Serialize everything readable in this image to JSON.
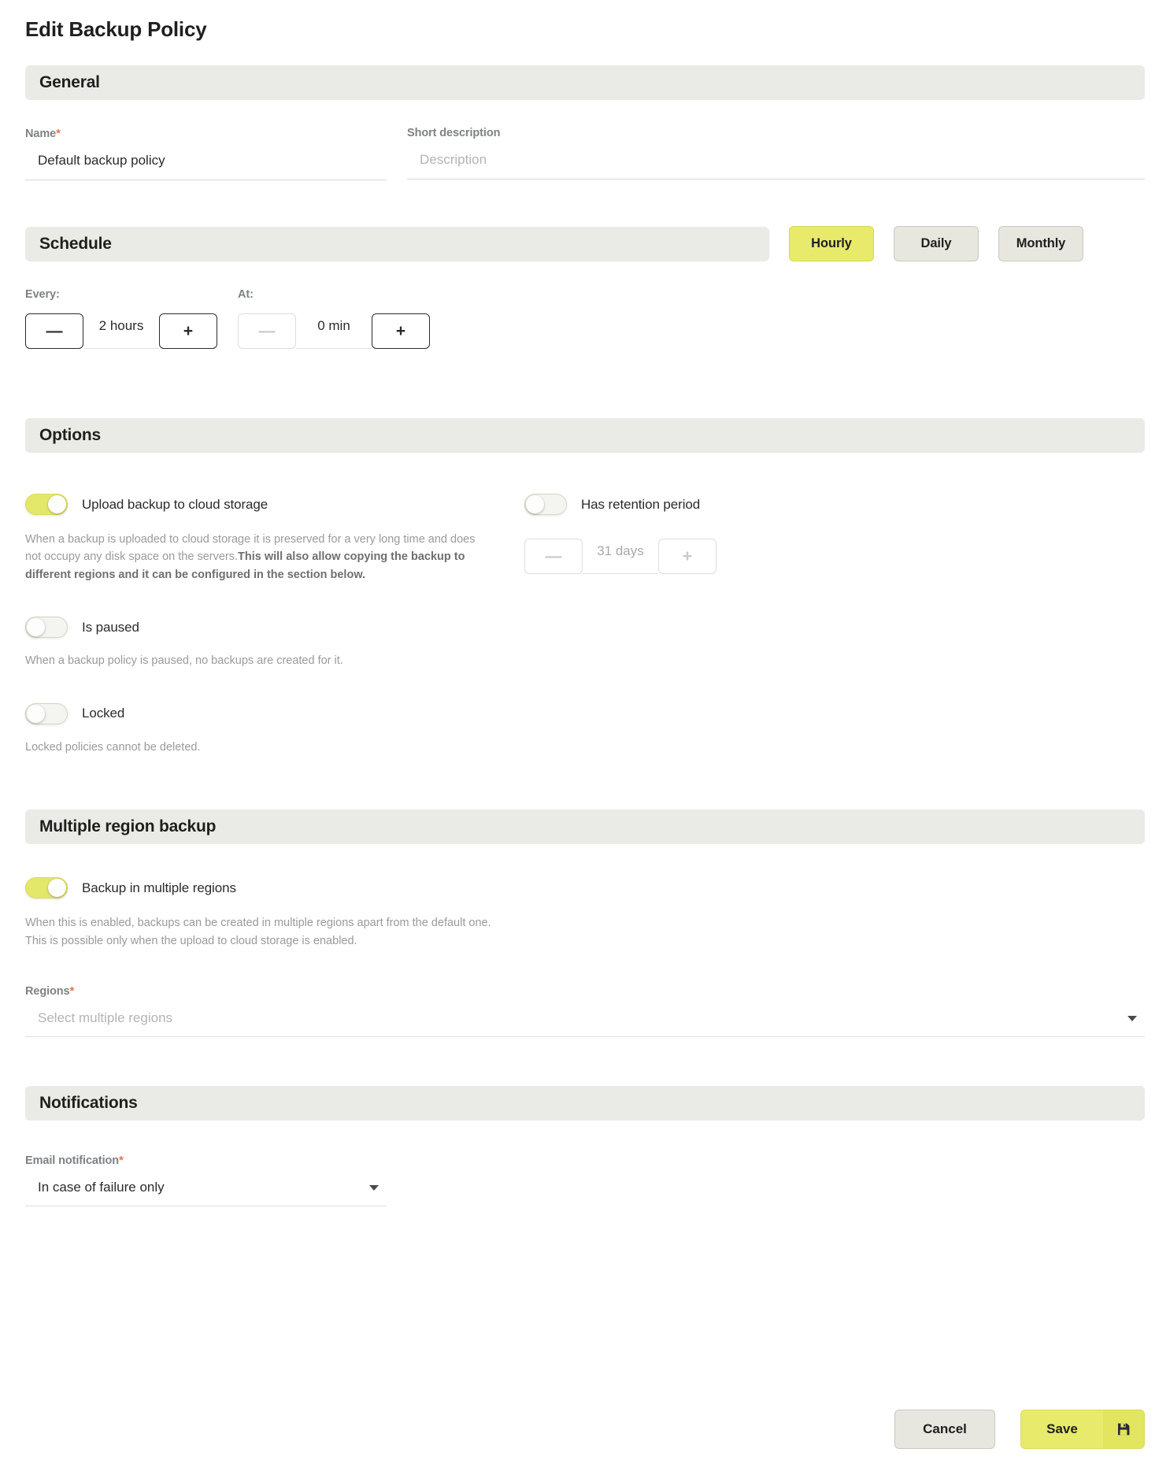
{
  "page_title": "Edit Backup Policy",
  "general": {
    "section_title": "General",
    "name_label": "Name",
    "name_required": "*",
    "name_value": "Default backup policy",
    "desc_label": "Short description",
    "desc_value": "",
    "desc_placeholder": "Description"
  },
  "schedule": {
    "section_title": "Schedule",
    "tabs": [
      {
        "label": "Hourly",
        "active": true
      },
      {
        "label": "Daily",
        "active": false
      },
      {
        "label": "Monthly",
        "active": false
      }
    ],
    "every_label": "Every:",
    "every_value": "2 hours",
    "every_minus": "—",
    "every_plus": "+",
    "at_label": "At:",
    "at_value": "0 min",
    "at_minus": "—",
    "at_plus": "+"
  },
  "options": {
    "section_title": "Options",
    "upload": {
      "label": "Upload backup to cloud storage",
      "state": "on",
      "help_normal": "When a backup is uploaded to cloud storage it is preserved for a very long time and does not occupy any disk space on the servers.",
      "help_bold": "This will also allow copying the backup to different regions and it can be configured in the section below."
    },
    "retention": {
      "label": "Has retention period",
      "state": "off",
      "value": "31 days",
      "minus": "—",
      "plus": "+"
    },
    "paused": {
      "label": "Is paused",
      "state": "off",
      "help": "When a backup policy is paused, no backups are created for it."
    },
    "locked": {
      "label": "Locked",
      "state": "off",
      "help": "Locked policies cannot be deleted."
    }
  },
  "multi_region": {
    "section_title": "Multiple region backup",
    "toggle_label": "Backup in multiple regions",
    "toggle_state": "on",
    "help_line1": "When this is enabled, backups can be created in multiple regions apart from the default one.",
    "help_line2": "This is possible only when the upload to cloud storage is enabled.",
    "regions_label": "Regions",
    "regions_required": "*",
    "regions_value": "",
    "regions_placeholder": "Select multiple regions"
  },
  "notifications": {
    "section_title": "Notifications",
    "email_label": "Email notification",
    "email_required": "*",
    "email_value": "In case of failure only"
  },
  "footer": {
    "cancel_label": "Cancel",
    "save_label": "Save",
    "save_icon": "floppy-disk-icon"
  },
  "colors": {
    "accent": "#e7ea6b",
    "toggle_on": "#e3e86a",
    "section_bg": "#eaeae6",
    "required": "#e8734a"
  }
}
